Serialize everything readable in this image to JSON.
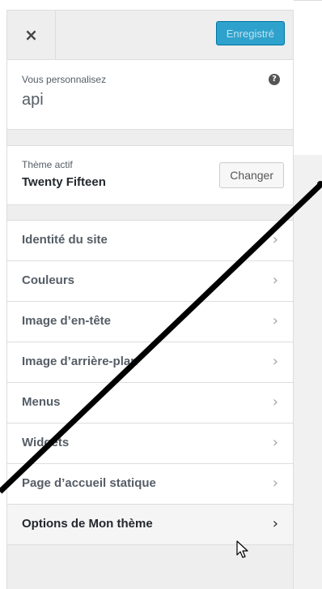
{
  "header": {
    "close_glyph": "×",
    "close_icon": "close-icon",
    "save_label": "Enregistré",
    "accent": "#2ea2cc"
  },
  "info": {
    "small_label": "Vous personnalisez",
    "site_name": "api",
    "help_glyph": "?",
    "help_icon": "help-icon"
  },
  "theme": {
    "small_label": "Thème actif",
    "name": "Twenty Fifteen",
    "change_label": "Changer"
  },
  "sections": [
    {
      "label": "Identité du site",
      "chevron": "›"
    },
    {
      "label": "Couleurs",
      "chevron": "›"
    },
    {
      "label": "Image d’en-tête",
      "chevron": "›"
    },
    {
      "label": "Image d’arrière-plan",
      "chevron": "›"
    },
    {
      "label": "Menus",
      "chevron": "›"
    },
    {
      "label": "Widgets",
      "chevron": "›"
    },
    {
      "label": "Page d’accueil statique",
      "chevron": "›"
    },
    {
      "label": "Options de Mon thème",
      "chevron": "›"
    }
  ]
}
